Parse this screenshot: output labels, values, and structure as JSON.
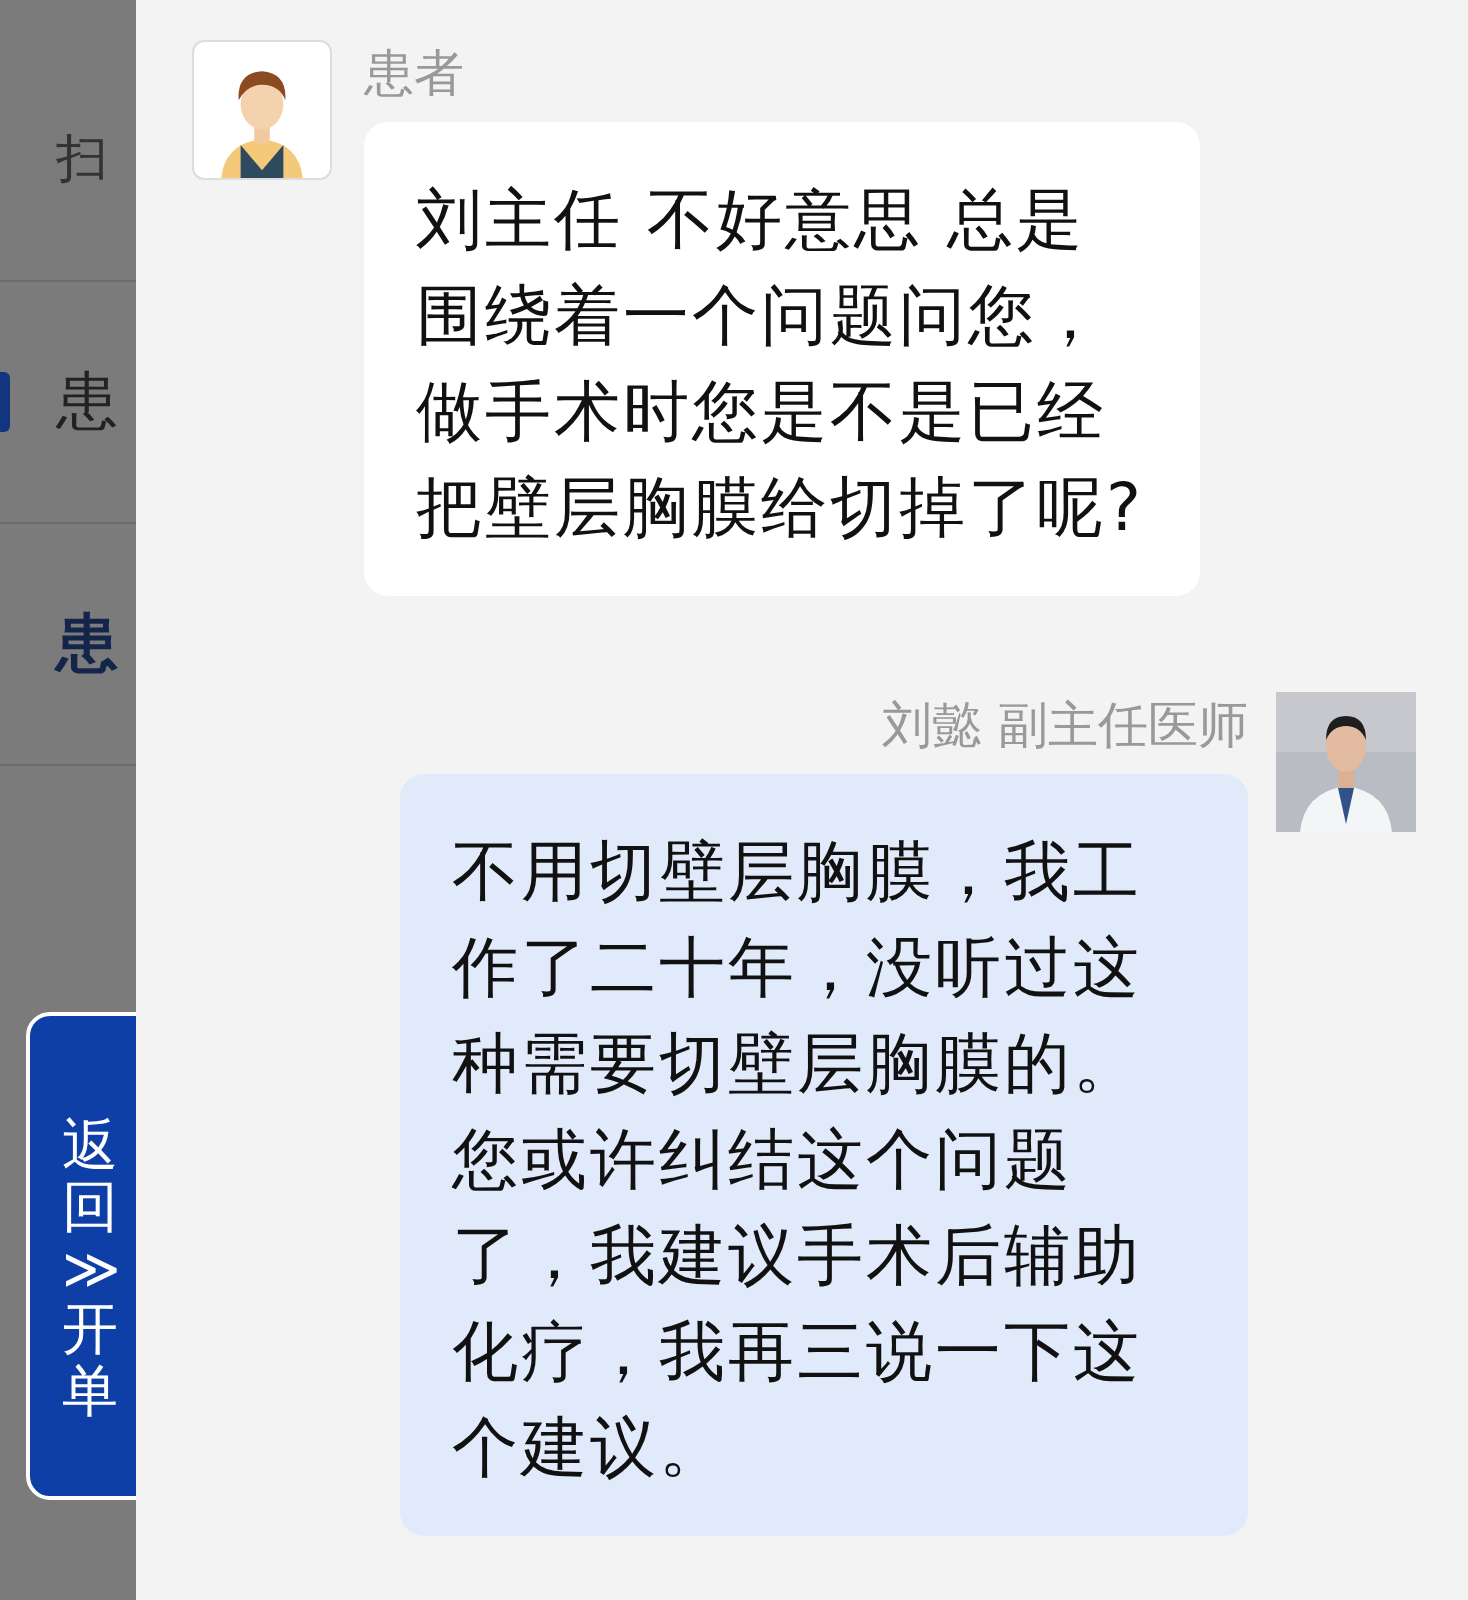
{
  "background_page": {
    "items": [
      {
        "text": "扫",
        "kind": "plain"
      },
      {
        "text": "患",
        "kind": "selected"
      },
      {
        "text": "患",
        "kind": "heading"
      }
    ]
  },
  "float_button": {
    "label": "返回≫开单"
  },
  "messages": [
    {
      "kind": "incoming",
      "sender": "患者",
      "text": "刘主任 不好意思 总是围绕着一个问题问您，做手术时您是不是已经把壁层胸膜给切掉了呢?"
    },
    {
      "kind": "outgoing",
      "sender": "刘懿 副主任医师",
      "text": "不用切壁层胸膜，我工作了二十年，没听过这种需要切壁层胸膜的。您或许纠结这个问题了，我建议手术后辅助化疗，我再三说一下这个建议。"
    }
  ]
}
